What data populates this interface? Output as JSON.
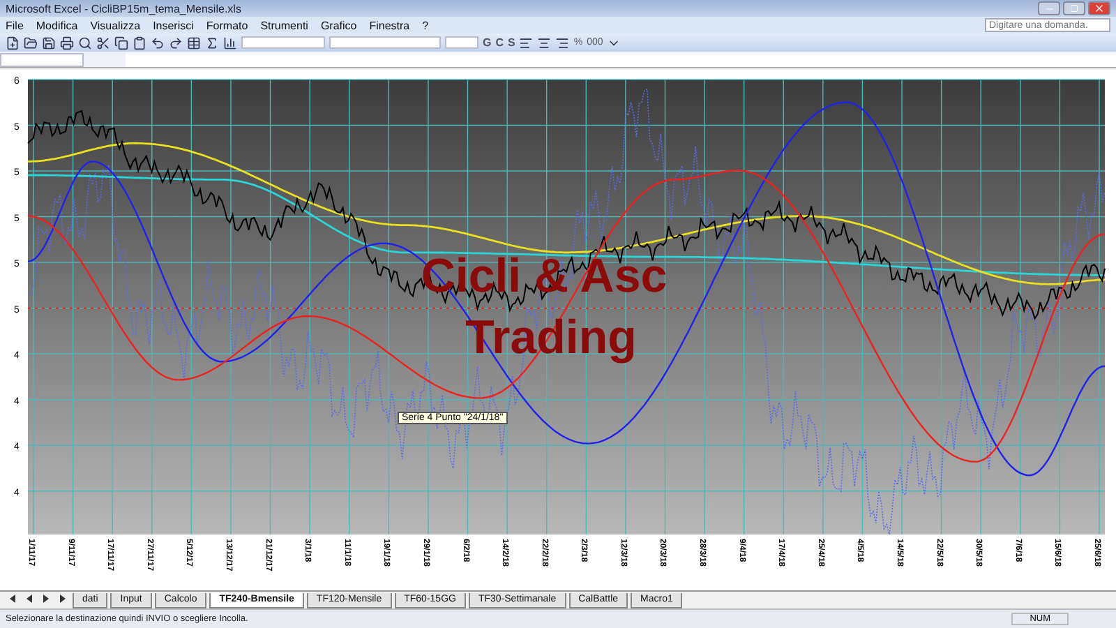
{
  "window": {
    "title": "Microsoft Excel - CicliBP15m_tema_Mensile.xls"
  },
  "menu": [
    "File",
    "Modifica",
    "Visualizza",
    "Inserisci",
    "Formato",
    "Strumenti",
    "Grafico",
    "Finestra",
    "?"
  ],
  "help_box": {
    "placeholder": "Digitare una domanda."
  },
  "format_buttons": [
    "G",
    "C",
    "S"
  ],
  "format_labels": [
    "%",
    "000"
  ],
  "chart": {
    "overlay_lines": [
      "Cicli & Asc",
      "Trading"
    ],
    "yticks": [
      "6",
      "5",
      "5",
      "5",
      "5",
      "5",
      "4",
      "4",
      "4",
      "4"
    ],
    "xticks": [
      "1/11/17",
      "9/11/17",
      "17/11/17",
      "27/11/17",
      "5/12/17",
      "13/12/17",
      "21/12/17",
      "3/1/18",
      "11/1/18",
      "19/1/18",
      "29/1/18",
      "6/2/18",
      "14/2/18",
      "22/2/18",
      "2/3/18",
      "12/3/18",
      "20/3/18",
      "28/3/18",
      "9/4/18",
      "17/4/18",
      "25/4/18",
      "4/5/18",
      "14/5/18",
      "22/5/18",
      "30/5/18",
      "7/6/18",
      "15/6/18",
      "25/6/18"
    ],
    "tooltip": "Serie 4 Punto \"24/1/18\""
  },
  "sheet_tabs": [
    {
      "label": "dati",
      "selected": false
    },
    {
      "label": "Input",
      "selected": false
    },
    {
      "label": "Calcolo",
      "selected": false
    },
    {
      "label": "TF240-Bmensile",
      "selected": true
    },
    {
      "label": "TF120-Mensile",
      "selected": false
    },
    {
      "label": "TF60-15GG",
      "selected": false
    },
    {
      "label": "TF30-Settimanale",
      "selected": false
    },
    {
      "label": "CalBattle",
      "selected": false
    },
    {
      "label": "Macro1",
      "selected": false
    }
  ],
  "status_bar": {
    "message": "Selezionare la destinazione quindi INVIO o scegliere Incolla.",
    "indicator": "NUM"
  }
}
